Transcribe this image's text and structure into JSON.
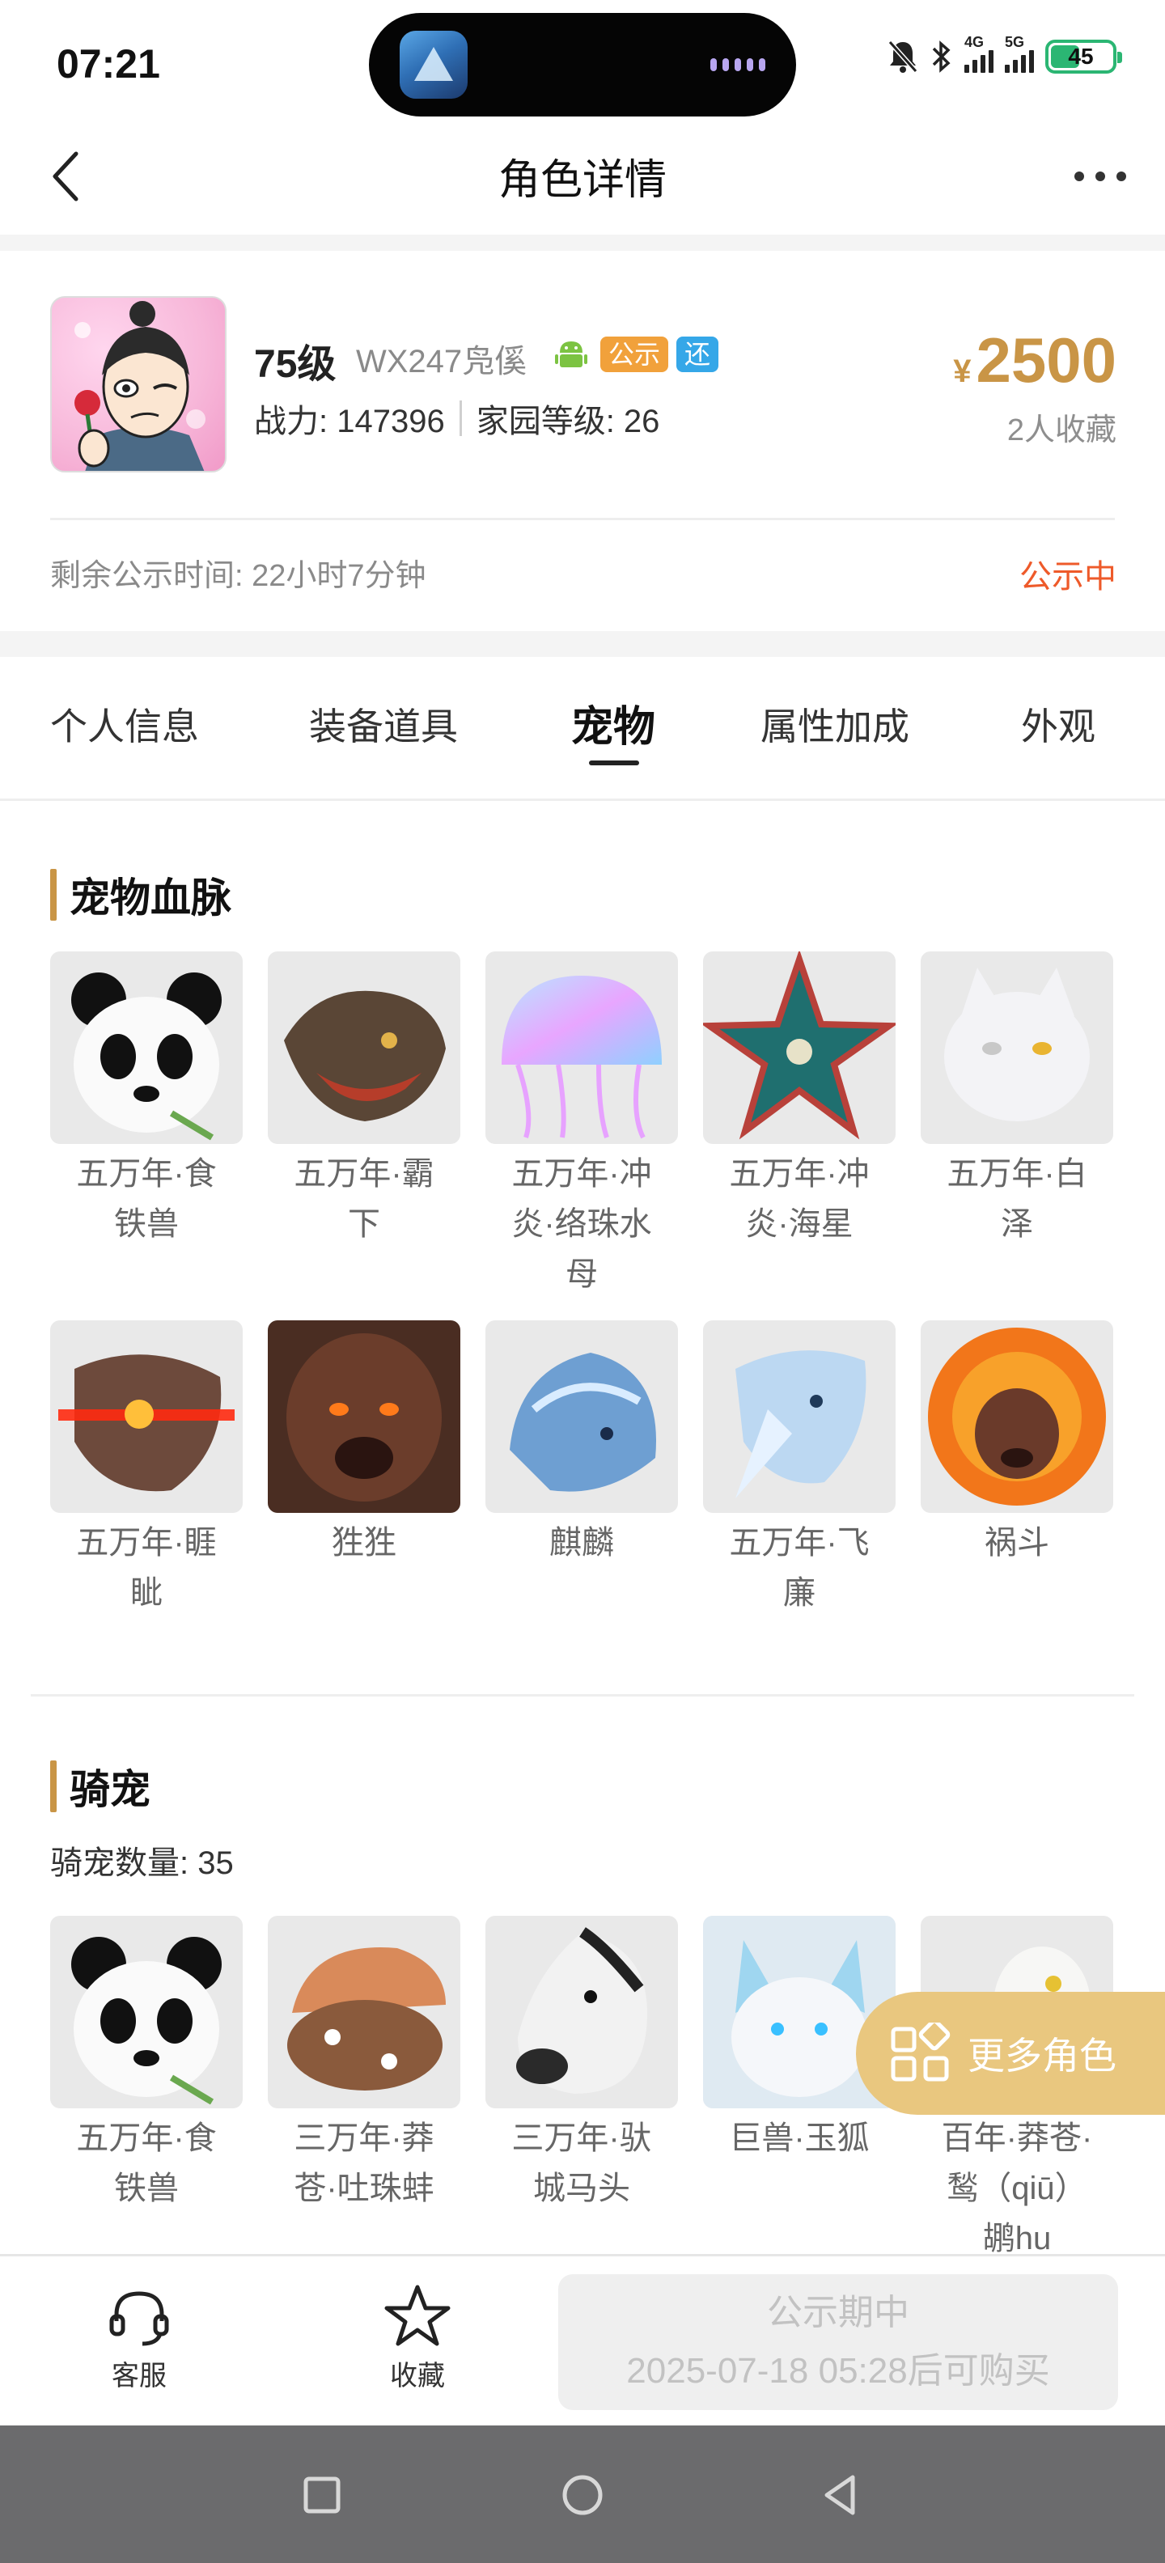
{
  "status_bar": {
    "time": "07:21",
    "battery": "45",
    "signal_1": "4G",
    "signal_2": "5G"
  },
  "nav": {
    "title": "角色详情"
  },
  "role": {
    "level": "75级",
    "server": "WX247凫傒",
    "tag_public": "公示",
    "tag_return": "还",
    "power": "战力: 147396",
    "home_level": "家园等级: 26",
    "currency": "¥",
    "price": "2500",
    "favorites": "2人收藏",
    "remain_time": "剩余公示时间: 22小时7分钟",
    "status": "公示中"
  },
  "tabs": [
    {
      "label": "个人信息"
    },
    {
      "label": "装备道具"
    },
    {
      "label": "宠物"
    },
    {
      "label": "属性加成"
    },
    {
      "label": "外观"
    }
  ],
  "active_tab": "宠物",
  "pet_bloodline": {
    "title": "宠物血脉",
    "items": [
      {
        "name": "五万年·食铁兽",
        "icon": "panda-icon"
      },
      {
        "name": "五万年·霸下",
        "icon": "dragon-turtle-icon"
      },
      {
        "name": "五万年·冲炎·络珠水母",
        "icon": "jellyfish-icon"
      },
      {
        "name": "五万年·冲炎·海星",
        "icon": "starfish-icon"
      },
      {
        "name": "五万年·白泽",
        "icon": "white-cat-icon"
      },
      {
        "name": "五万年·睚眦",
        "icon": "dragon-laser-icon"
      },
      {
        "name": "狌狌",
        "icon": "ape-icon"
      },
      {
        "name": "麒麟",
        "icon": "blue-dragon-icon"
      },
      {
        "name": "五万年·飞廉",
        "icon": "ice-bird-icon"
      },
      {
        "name": "祸斗",
        "icon": "fire-lion-icon"
      }
    ]
  },
  "riding_pets": {
    "title": "骑宠",
    "count_label": "骑宠数量:",
    "count": "35",
    "items": [
      {
        "name": "五万年·食铁兽",
        "icon": "panda-icon"
      },
      {
        "name": "三万年·莽苍·吐珠蚌",
        "icon": "clam-icon"
      },
      {
        "name": "三万年·驮城马头",
        "icon": "horse-icon"
      },
      {
        "name": "巨兽·玉狐",
        "icon": "jade-fox-icon"
      },
      {
        "name": "百年·莽苍·鹙（qiū）鹕hu",
        "icon": "pelican-icon"
      }
    ]
  },
  "floating": {
    "more_roles": "更多角色"
  },
  "bottom": {
    "service": "客服",
    "favorite": "收藏",
    "buy_line1": "公示期中",
    "buy_line2": "2025-07-18 05:28后可购买"
  }
}
